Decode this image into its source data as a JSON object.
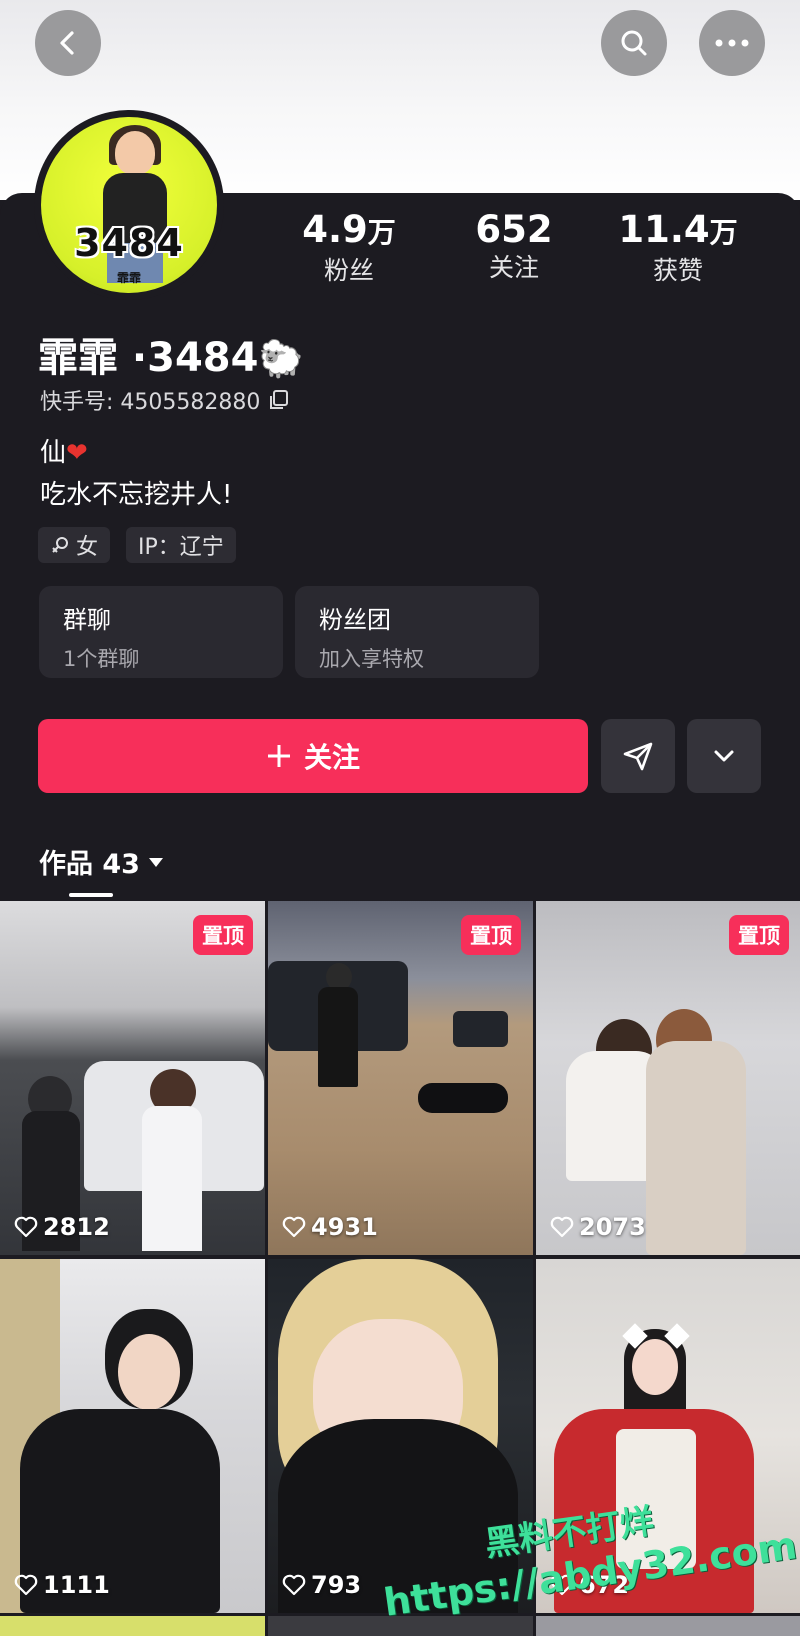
{
  "header": {
    "back_icon": "chevron-left-icon",
    "search_icon": "search-icon",
    "more_icon": "more-horizontal-icon"
  },
  "avatar": {
    "badge_text": "3484",
    "badge_sub": "霏霏"
  },
  "stats": {
    "fans_value": "4.9",
    "fans_unit": "万",
    "fans_label": "粉丝",
    "follow_value": "652",
    "follow_label": "关注",
    "likes_value": "11.4",
    "likes_unit": "万",
    "likes_label": "获赞"
  },
  "profile": {
    "name": "霏霏 ·3484",
    "name_emoji": "🐑",
    "kuaishou_id": "快手号: 4505582880",
    "bio_line1": "仙",
    "bio_emoji": "❤",
    "bio_line2": "吃水不忘挖井人!",
    "gender_tag": "女",
    "ip_tag": "IP：辽宁"
  },
  "boxes": {
    "group_title": "群聊",
    "group_sub": "1个群聊",
    "fanclub_title": "粉丝团",
    "fanclub_sub": "加入享特权"
  },
  "actions": {
    "follow_label": "关注",
    "follow_plus": "+"
  },
  "tabs": {
    "works_label": "作品 43"
  },
  "videos": [
    {
      "pinned": true,
      "pin_label": "置顶",
      "likes": "2812"
    },
    {
      "pinned": true,
      "pin_label": "置顶",
      "likes": "4931"
    },
    {
      "pinned": true,
      "pin_label": "置顶",
      "likes": "2073"
    },
    {
      "pinned": false,
      "likes": "1111"
    },
    {
      "pinned": false,
      "likes": "793"
    },
    {
      "pinned": false,
      "likes": "672"
    }
  ],
  "watermark": {
    "line1": "黑料不打烊",
    "line2": "https://abdy32.com"
  },
  "colors": {
    "accent": "#f72f5a",
    "background": "#1c1b21"
  }
}
